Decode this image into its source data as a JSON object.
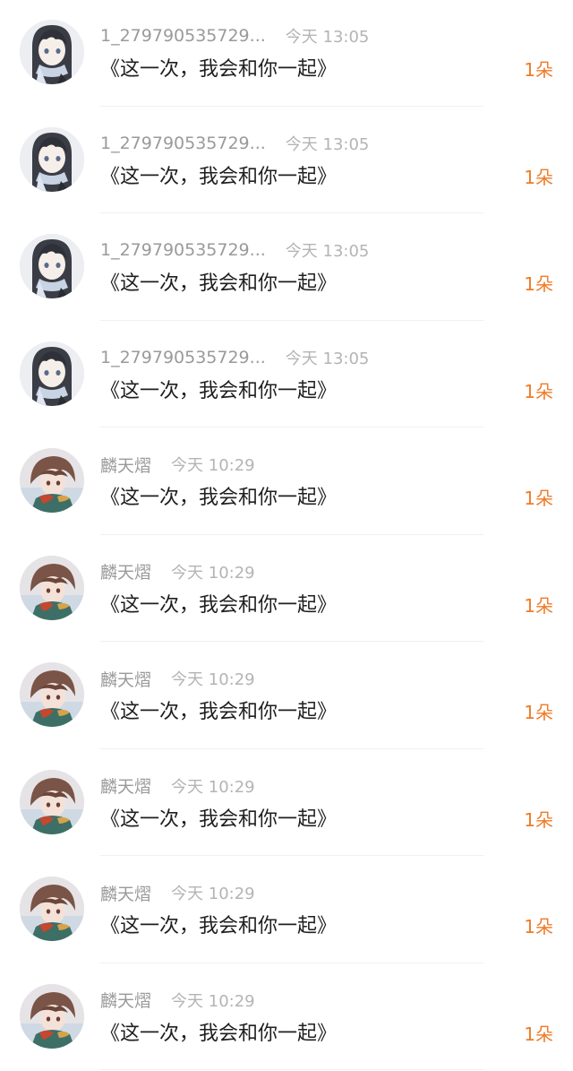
{
  "gifts": [
    {
      "user": "1_279790535729...",
      "time": "今天 13:05",
      "message": "《这一次，我会和你一起》",
      "amount": "1朵",
      "avatar": "girl-avatar"
    },
    {
      "user": "1_279790535729...",
      "time": "今天 13:05",
      "message": "《这一次，我会和你一起》",
      "amount": "1朵",
      "avatar": "girl-avatar"
    },
    {
      "user": "1_279790535729...",
      "time": "今天 13:05",
      "message": "《这一次，我会和你一起》",
      "amount": "1朵",
      "avatar": "girl-avatar"
    },
    {
      "user": "1_279790535729...",
      "time": "今天 13:05",
      "message": "《这一次，我会和你一起》",
      "amount": "1朵",
      "avatar": "girl-avatar"
    },
    {
      "user": "麟天熠",
      "time": "今天 10:29",
      "message": "《这一次，我会和你一起》",
      "amount": "1朵",
      "avatar": "boy-avatar"
    },
    {
      "user": "麟天熠",
      "time": "今天 10:29",
      "message": "《这一次，我会和你一起》",
      "amount": "1朵",
      "avatar": "boy-avatar"
    },
    {
      "user": "麟天熠",
      "time": "今天 10:29",
      "message": "《这一次，我会和你一起》",
      "amount": "1朵",
      "avatar": "boy-avatar"
    },
    {
      "user": "麟天熠",
      "time": "今天 10:29",
      "message": "《这一次，我会和你一起》",
      "amount": "1朵",
      "avatar": "boy-avatar"
    },
    {
      "user": "麟天熠",
      "time": "今天 10:29",
      "message": "《这一次，我会和你一起》",
      "amount": "1朵",
      "avatar": "boy-avatar"
    },
    {
      "user": "麟天熠",
      "time": "今天 10:29",
      "message": "《这一次，我会和你一起》",
      "amount": "1朵",
      "avatar": "boy-avatar"
    }
  ],
  "colors": {
    "amount": "#ef7b27",
    "username": "#9a9a9a",
    "time": "#b4b4b4",
    "message": "#1f1f1f"
  }
}
